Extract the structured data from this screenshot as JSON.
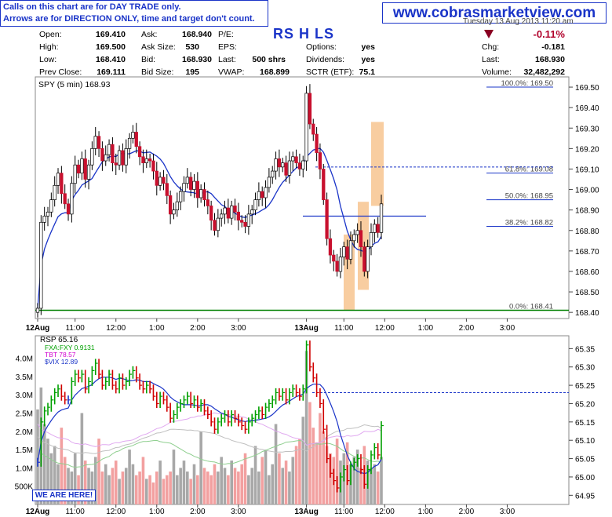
{
  "banner": {
    "note_line1": "Calls on this chart are for DAY TRADE only.",
    "note_line2": "Arrows are for DIRECTION ONLY, time and target don't count.",
    "website": "www.cobrasmarketview.com",
    "timestamp": "Tuesday 13 Aug 2013 11:20 am",
    "we_are_here": "WE ARE HERE!"
  },
  "quote": {
    "symbol_left": "RS",
    "symbol_h": "H",
    "symbol_right": "LS",
    "change_pct": "-0.11%",
    "open_label": "Open:",
    "open": "169.410",
    "high_label": "High:",
    "high": "169.500",
    "low_label": "Low:",
    "low": "168.410",
    "prev_label": "Prev Close:",
    "prev": "169.111",
    "ask_label": "Ask:",
    "ask": "168.940",
    "asksize_label": "Ask Size:",
    "asksize": "530",
    "bid_label": "Bid:",
    "bid": "168.930",
    "bidsize_label": "Bid Size:",
    "bidsize": "195",
    "pe_label": "P/E:",
    "pe": "",
    "eps_label": "EPS:",
    "eps": "",
    "last_label": "Last:",
    "last_shrs": "500 shrs",
    "vwap_label": "VWAP:",
    "vwap": "168.899",
    "options_label": "Options:",
    "options": "yes",
    "dividends_label": "Dividends:",
    "dividends": "yes",
    "sctr_label": "SCTR (ETF):",
    "sctr": "75.1",
    "chg_label": "Chg:",
    "chg": "-0.181",
    "last2_label": "Last:",
    "last2": "168.930",
    "volume_label": "Volume:",
    "volume": "32,482,292"
  },
  "colors": {
    "up_candle": "#ffffff",
    "down_candle": "#c8102e",
    "candle_outline": "#000000",
    "ma": "#1a34c8",
    "fib": "#1a34c8",
    "target_box": "#f7c48f",
    "support": "#008000",
    "volume_up": "#a8a8a8",
    "volume_down": "#f2a0a0",
    "rsp_up": "#00a000",
    "rsp_down": "#d00000",
    "rsp_flat": "#1a34c8",
    "fxa": "#8fcf8f",
    "tbt": "#e0a8f0",
    "vix": "#c0c0c0"
  },
  "chart_data": [
    {
      "type": "candlestick",
      "title": "SPY (5 min) 168.93",
      "x_ticks": [
        "12Aug",
        "11:00",
        "12:00",
        "1:00",
        "2:00",
        "3:00",
        "13Aug",
        "11:00",
        "12:00",
        "1:00",
        "2:00",
        "3:00"
      ],
      "y_ticks": [
        168.4,
        168.5,
        168.6,
        168.7,
        168.8,
        168.9,
        169.0,
        169.1,
        169.2,
        169.3,
        169.4,
        169.5
      ],
      "ylim": [
        168.37,
        169.55
      ],
      "closes": [
        168.42,
        168.84,
        168.87,
        168.89,
        168.95,
        169.02,
        169.08,
        168.98,
        168.93,
        168.88,
        169.03,
        169.12,
        169.08,
        169.15,
        169.05,
        169.12,
        169.2,
        169.26,
        169.2,
        169.14,
        169.17,
        169.22,
        169.13,
        169.12,
        169.19,
        169.12,
        169.2,
        169.25,
        169.28,
        169.21,
        169.16,
        169.13,
        169.15,
        169.14,
        169.09,
        169.02,
        169.06,
        169.03,
        168.97,
        168.88,
        168.9,
        168.94,
        168.99,
        169.03,
        169.06,
        169.0,
        169.04,
        168.96,
        169.0,
        168.95,
        168.92,
        168.85,
        168.8,
        168.86,
        168.88,
        168.91,
        168.86,
        168.92,
        168.89,
        168.85,
        168.84,
        168.82,
        168.88,
        168.9,
        168.95,
        168.99,
        168.96,
        169.01,
        169.06,
        169.09,
        169.15,
        169.11,
        169.13,
        169.07,
        169.14,
        169.16,
        169.13,
        169.1,
        169.14,
        169.47,
        169.32,
        169.27,
        169.18,
        169.1,
        168.95,
        168.76,
        168.68,
        168.65,
        168.6,
        168.67,
        168.72,
        168.66,
        168.75,
        168.78,
        168.8,
        168.72,
        168.6,
        168.72,
        168.79,
        168.83,
        168.79,
        168.93
      ],
      "indicators": [
        "MA (blue)"
      ],
      "fibonacci": [
        {
          "label": "100.0%: 169.50",
          "value": 169.5
        },
        {
          "label": "61.8%: 169.08",
          "value": 169.08
        },
        {
          "label": "50.0%: 168.95",
          "value": 168.95
        },
        {
          "label": "38.2%: 168.82",
          "value": 168.82
        },
        {
          "label": "0.0%: 168.41",
          "value": 168.41
        }
      ],
      "resistance_line": 169.11,
      "pivot_line": 168.87,
      "support_line": 168.41,
      "target_boxes": [
        [
          168.41,
          168.78
        ],
        [
          168.51,
          168.94
        ],
        [
          168.92,
          169.33
        ]
      ]
    },
    {
      "type": "bar",
      "title": "RSP 65.16",
      "legend": [
        "FXA:FXY 0.9131",
        "TBT 78.57",
        "$VIX 12.89"
      ],
      "x_ticks": [
        "12Aug",
        "11:00",
        "12:00",
        "1:00",
        "2:00",
        "3:00",
        "13Aug",
        "11:00",
        "12:00",
        "1:00",
        "2:00",
        "3:00"
      ],
      "y_ticks_right": [
        64.95,
        65.0,
        65.05,
        65.1,
        65.15,
        65.2,
        65.25,
        65.3,
        65.35
      ],
      "y_ticks_left": [
        "500K",
        "1.0M",
        "1.5M",
        "2.0M",
        "2.5M",
        "3.0M",
        "3.5M",
        "4.0M"
      ],
      "volume_millions": [
        2.6,
        3.2,
        2.2,
        1.8,
        1.4,
        1.6,
        1.1,
        2.1,
        1.3,
        1.0,
        0.9,
        1.4,
        0.8,
        2.5,
        1.2,
        1.0,
        0.9,
        1.3,
        1.8,
        0.9,
        1.1,
        0.8,
        1.0,
        1.2,
        0.7,
        0.9,
        1.0,
        1.5,
        1.1,
        0.8,
        0.9,
        1.3,
        0.7,
        0.8,
        0.6,
        0.9,
        1.2,
        0.7,
        0.8,
        0.9,
        1.5,
        0.8,
        1.0,
        1.2,
        0.9,
        0.7,
        1.1,
        0.8,
        2.0,
        1.0,
        0.9,
        0.8,
        1.1,
        0.9,
        1.3,
        1.0,
        0.8,
        1.2,
        1.0,
        0.9,
        1.1,
        1.4,
        0.8,
        1.0,
        1.6,
        0.9,
        1.3,
        1.5,
        0.8,
        1.1,
        2.2,
        1.4,
        1.0,
        1.2,
        0.9,
        1.3,
        1.6,
        1.8,
        2.4,
        4.2,
        2.8,
        2.1,
        1.7,
        2.5,
        2.0,
        1.6,
        1.4,
        1.3,
        1.8,
        1.2,
        1.4,
        1.7,
        1.1,
        1.3,
        1.5,
        1.0,
        1.6,
        1.2,
        1.0,
        1.1,
        0.9,
        1.3
      ],
      "rsp_closes": [
        65.04,
        65.15,
        65.18,
        65.19,
        65.21,
        65.23,
        65.24,
        65.22,
        65.21,
        65.21,
        65.26,
        65.28,
        65.27,
        65.28,
        65.24,
        65.26,
        65.29,
        65.31,
        65.28,
        65.25,
        65.26,
        65.28,
        65.25,
        65.24,
        65.27,
        65.25,
        65.26,
        65.28,
        65.29,
        65.27,
        65.25,
        65.24,
        65.25,
        65.24,
        65.22,
        65.2,
        65.22,
        65.21,
        65.19,
        65.16,
        65.17,
        65.19,
        65.2,
        65.21,
        65.22,
        65.2,
        65.21,
        65.19,
        65.2,
        65.18,
        65.17,
        65.15,
        65.13,
        65.15,
        65.16,
        65.17,
        65.15,
        65.17,
        65.16,
        65.15,
        65.14,
        65.13,
        65.15,
        65.16,
        65.17,
        65.18,
        65.17,
        65.19,
        65.2,
        65.21,
        65.23,
        65.22,
        65.23,
        65.21,
        65.23,
        65.24,
        65.23,
        65.22,
        65.24,
        65.36,
        65.3,
        65.27,
        65.23,
        65.2,
        65.13,
        65.05,
        65.01,
        64.99,
        64.97,
        65.0,
        65.02,
        64.99,
        65.03,
        65.04,
        65.05,
        65.02,
        64.98,
        65.02,
        65.06,
        65.08,
        65.06,
        65.14
      ],
      "resistance_line": 65.23
    }
  ]
}
